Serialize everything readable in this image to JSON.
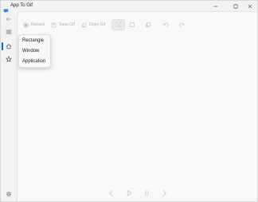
{
  "window": {
    "title": "App To Gif"
  },
  "toolbar": {
    "record_label": "Record",
    "save_gif_label": "Save Gif",
    "copy_gif_label": "Copy Gif"
  },
  "capture_menu": {
    "items": [
      "Rectangle",
      "Window",
      "Application"
    ]
  },
  "colors": {
    "accent": "#0067c0"
  }
}
